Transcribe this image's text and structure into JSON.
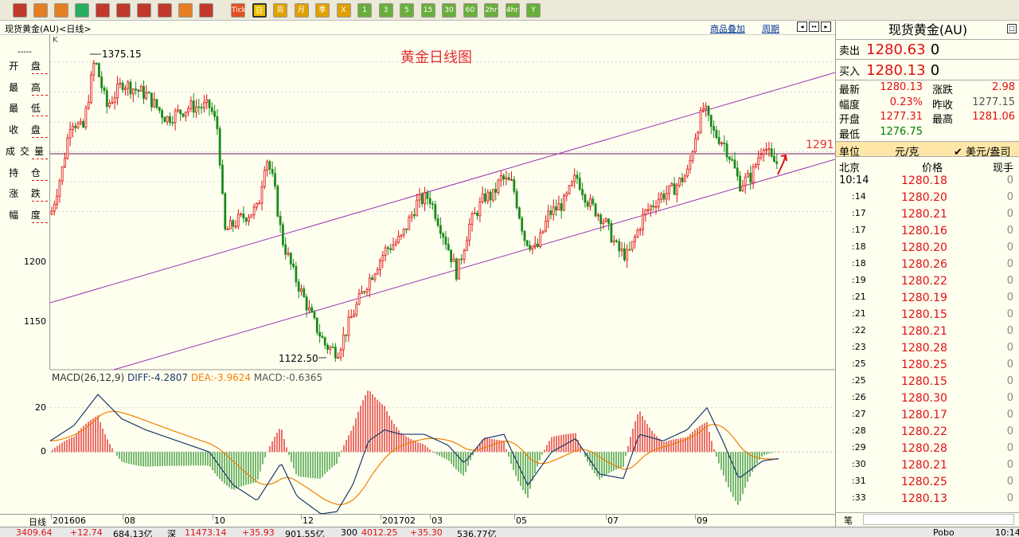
{
  "toolbar": {
    "buttons": [
      {
        "name": "home-icon",
        "color": "#c0392b"
      },
      {
        "name": "book-icon",
        "color": "#e67e22"
      },
      {
        "name": "card-icon",
        "color": "#e67e22"
      },
      {
        "name": "refresh-icon",
        "color": "#27ae60"
      },
      {
        "name": "zoom-in-icon",
        "color": "#c0392b"
      },
      {
        "name": "zoom-out-icon",
        "color": "#c0392b"
      },
      {
        "name": "window-icon",
        "color": "#c0392b"
      },
      {
        "name": "pen-icon",
        "color": "#c0392b"
      },
      {
        "name": "chart-tool-icon",
        "color": "#e67e22"
      },
      {
        "name": "filter-icon",
        "color": "#c0392b"
      }
    ],
    "periods": [
      "Tick",
      "日",
      "周",
      "月",
      "季",
      "X",
      "1",
      "3",
      "5",
      "15",
      "30",
      "60",
      "2hr",
      "4hr",
      "Y"
    ],
    "active_period": "日"
  },
  "header": {
    "title": "现货黄金(AU)<日线>",
    "overlay_label": "商品叠加",
    "period_label": "周期"
  },
  "chart_title": "黄金日线图",
  "chart_k_label": "K",
  "left_indicators": [
    {
      "label": "开 盘"
    },
    {
      "label": "最 高"
    },
    {
      "label": "最 低"
    },
    {
      "label": "收 盘"
    },
    {
      "label": "成交量"
    },
    {
      "label": "持 仓"
    },
    {
      "label": "涨 跌"
    },
    {
      "label": "幅 度"
    }
  ],
  "left_dash": "-----",
  "price_axis": {
    "ticks": [
      {
        "label": "1200",
        "value": 1200
      },
      {
        "label": "1150",
        "value": 1150
      }
    ],
    "range": [
      1110,
      1390
    ]
  },
  "annotations": {
    "high": "1375.15",
    "low": "1122.50",
    "hline_label": "1291"
  },
  "macd": {
    "label": "MACD(26,12,9)",
    "diff": "DIFF:-4.2807",
    "dea": "DEA:-3.9624",
    "macd": "MACD:-0.6365",
    "ticks": [
      {
        "label": "20",
        "value": 20
      },
      {
        "label": "0",
        "value": 0
      }
    ],
    "range": [
      -28,
      30
    ]
  },
  "x_axis": {
    "period_label": "日线",
    "labels": [
      "201606",
      "08",
      "10",
      "12",
      "201702",
      "03",
      "05",
      "07",
      "09"
    ]
  },
  "right_panel": {
    "title": "现货黄金(AU)",
    "sell_label": "卖出",
    "sell_price": "1280.63",
    "sell_qty": "0",
    "buy_label": "买入",
    "buy_price": "1280.13",
    "buy_qty": "0",
    "stats": [
      {
        "l1": "最新",
        "v1": "1280.13",
        "l2": "涨跌",
        "v2": "2.98"
      },
      {
        "l1": "幅度",
        "v1": "0.23%",
        "l2": "昨收",
        "v2": "1277.15"
      },
      {
        "l1": "开盘",
        "v1": "1277.31",
        "l2": "最高",
        "v2": "1281.06"
      },
      {
        "l1": "最低",
        "v1": "1276.75",
        "l2": "",
        "v2": ""
      }
    ],
    "unit_label": "单位",
    "unit_value": "元/克",
    "currency": "✔ 美元/盎司",
    "col_city": "北京",
    "col_price": "价格",
    "col_vol": "现手",
    "ticks": [
      {
        "t": "10:14",
        "p": "1280.18",
        "v": "0"
      },
      {
        "t": ":14",
        "p": "1280.20",
        "v": "0"
      },
      {
        "t": ":17",
        "p": "1280.21",
        "v": "0"
      },
      {
        "t": ":17",
        "p": "1280.16",
        "v": "0"
      },
      {
        "t": ":18",
        "p": "1280.20",
        "v": "0"
      },
      {
        "t": ":18",
        "p": "1280.26",
        "v": "0"
      },
      {
        "t": ":19",
        "p": "1280.22",
        "v": "0"
      },
      {
        "t": ":21",
        "p": "1280.19",
        "v": "0"
      },
      {
        "t": ":21",
        "p": "1280.15",
        "v": "0"
      },
      {
        "t": ":22",
        "p": "1280.21",
        "v": "0"
      },
      {
        "t": ":23",
        "p": "1280.28",
        "v": "0"
      },
      {
        "t": ":25",
        "p": "1280.25",
        "v": "0"
      },
      {
        "t": ":25",
        "p": "1280.15",
        "v": "0"
      },
      {
        "t": ":26",
        "p": "1280.30",
        "v": "0"
      },
      {
        "t": ":27",
        "p": "1280.17",
        "v": "0"
      },
      {
        "t": ":28",
        "p": "1280.22",
        "v": "0"
      },
      {
        "t": ":29",
        "p": "1280.28",
        "v": "0"
      },
      {
        "t": ":30",
        "p": "1280.21",
        "v": "0"
      },
      {
        "t": ":31",
        "p": "1280.25",
        "v": "0"
      },
      {
        "t": ":33",
        "p": "1280.13",
        "v": "0"
      }
    ],
    "footer_label": "笔"
  },
  "status_bar": [
    {
      "text": "3409.64",
      "color": "#e01010"
    },
    {
      "text": "+12.74",
      "color": "#e01010"
    },
    {
      "text": "684.13亿",
      "color": "#000"
    },
    {
      "text": "深",
      "color": "#000"
    },
    {
      "text": "11473.14",
      "color": "#e01010"
    },
    {
      "text": "+35.93",
      "color": "#e01010"
    },
    {
      "text": "901.55亿",
      "color": "#000"
    },
    {
      "text": "300",
      "color": "#000"
    },
    {
      "text": "4012.25",
      "color": "#e01010"
    },
    {
      "text": "+35.30",
      "color": "#e01010"
    },
    {
      "text": "536.77亿",
      "color": "#000"
    },
    {
      "text": "Pobo",
      "color": "#000"
    },
    {
      "text": "10:14",
      "color": "#000"
    }
  ],
  "colors": {
    "up": "#e01010",
    "down": "#1a8a1a",
    "channel": "#9b30b0",
    "hline": "#7a1a6a",
    "diff": "#1a3a6a",
    "dea": "#f08000"
  }
}
